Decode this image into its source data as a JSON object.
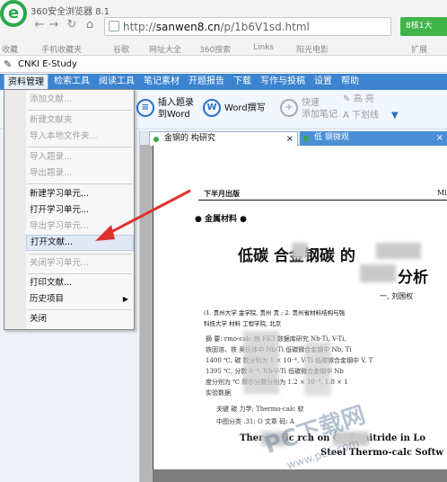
{
  "browser": {
    "title": "360安全浏览器 8.1",
    "url_prefix": "http://",
    "url_host": "sanwen8.cn",
    "url_path": "/p/1b6V1sd.html",
    "green_button": "8核1大",
    "favorites": [
      "收藏",
      "手机收藏夹",
      "谷歌",
      "网址大全",
      "360搜索",
      "Links",
      "阳光电影",
      "扩展"
    ]
  },
  "app": {
    "title": "CNKI E-Study",
    "menu": [
      "资料管理",
      "检索工具",
      "阅读工具",
      "笔记素材",
      "开题报告",
      "下载",
      "写作与投稿",
      "设置",
      "帮助"
    ]
  },
  "toolbar": {
    "insert_title": "插入题录\n到Word",
    "word_write": "Word撰写",
    "quick_note": "快速\n添加笔记",
    "highlight": "高 亮",
    "underline": "下划线"
  },
  "dropdown": {
    "items": [
      {
        "label": "添加文献...",
        "enabled": false
      },
      {
        "label": "新建文献夹",
        "enabled": false
      },
      {
        "label": "导入本地文件夹...",
        "enabled": false
      },
      {
        "label": "导入题录...",
        "enabled": false
      },
      {
        "label": "导出题录...",
        "enabled": false
      },
      {
        "label": "新建学习单元...",
        "enabled": true
      },
      {
        "label": "打开学习单元...",
        "enabled": true
      },
      {
        "label": "导出学习单元...",
        "enabled": false
      },
      {
        "label": "打开文献...",
        "enabled": true
      },
      {
        "label": "关闭学习单元...",
        "enabled": false
      },
      {
        "label": "打印文献...",
        "enabled": true
      },
      {
        "label": "历史项目",
        "enabled": true
      },
      {
        "label": "关闭",
        "enabled": true
      }
    ]
  },
  "tabs": [
    {
      "label": "金钢的      构研究"
    },
    {
      "label": "低    钢微观"
    }
  ],
  "document": {
    "header_left": "下半月出版",
    "header_right": "Mi",
    "section": "● 金属材料 ●",
    "title_line1": "低碳   合金钢碳      的",
    "title_line2": "分析",
    "authors": "一, 刘国权",
    "affil1": "(1. 贵州大学            金学院, 贵州  贵         ; 2. 贵州省材料结构与强",
    "affil2": "科技大学  材料          工程学院, 北京",
    "abstract_lines": [
      "摘  要:      rmo-calc 热         FE3 数据库研究 Nb-Ti, V-Ti,",
      "铁固溶、铁          奥氏体中        Nb-Ti 低碳微合金钢中 Nb, Ti",
      "1400 ℃, 碳        数分别为 1         × 10⁻⁴, V-Ti 低碳微合金钢中 V, T",
      "1395 ℃,         分数           0⁻⁴, Nb-V-Ti 低碳微合金钢中 Nb",
      "度分别为         ℃                  摩尔分数分别为 1.2 × 10⁻³, 1.8 × 1",
      "实验数据"
    ],
    "keywords": "关键        碳              力学;  Thermo-calc 软",
    "classification": "中图分类       .31; O        文章      码: A",
    "english1": "Therm        mic        rch on Carbonitride in Lo",
    "english2": "Steel       Thermo-calc Softw"
  },
  "watermark": {
    "main": "PC下载网",
    "sub": "www.pc6.com"
  }
}
